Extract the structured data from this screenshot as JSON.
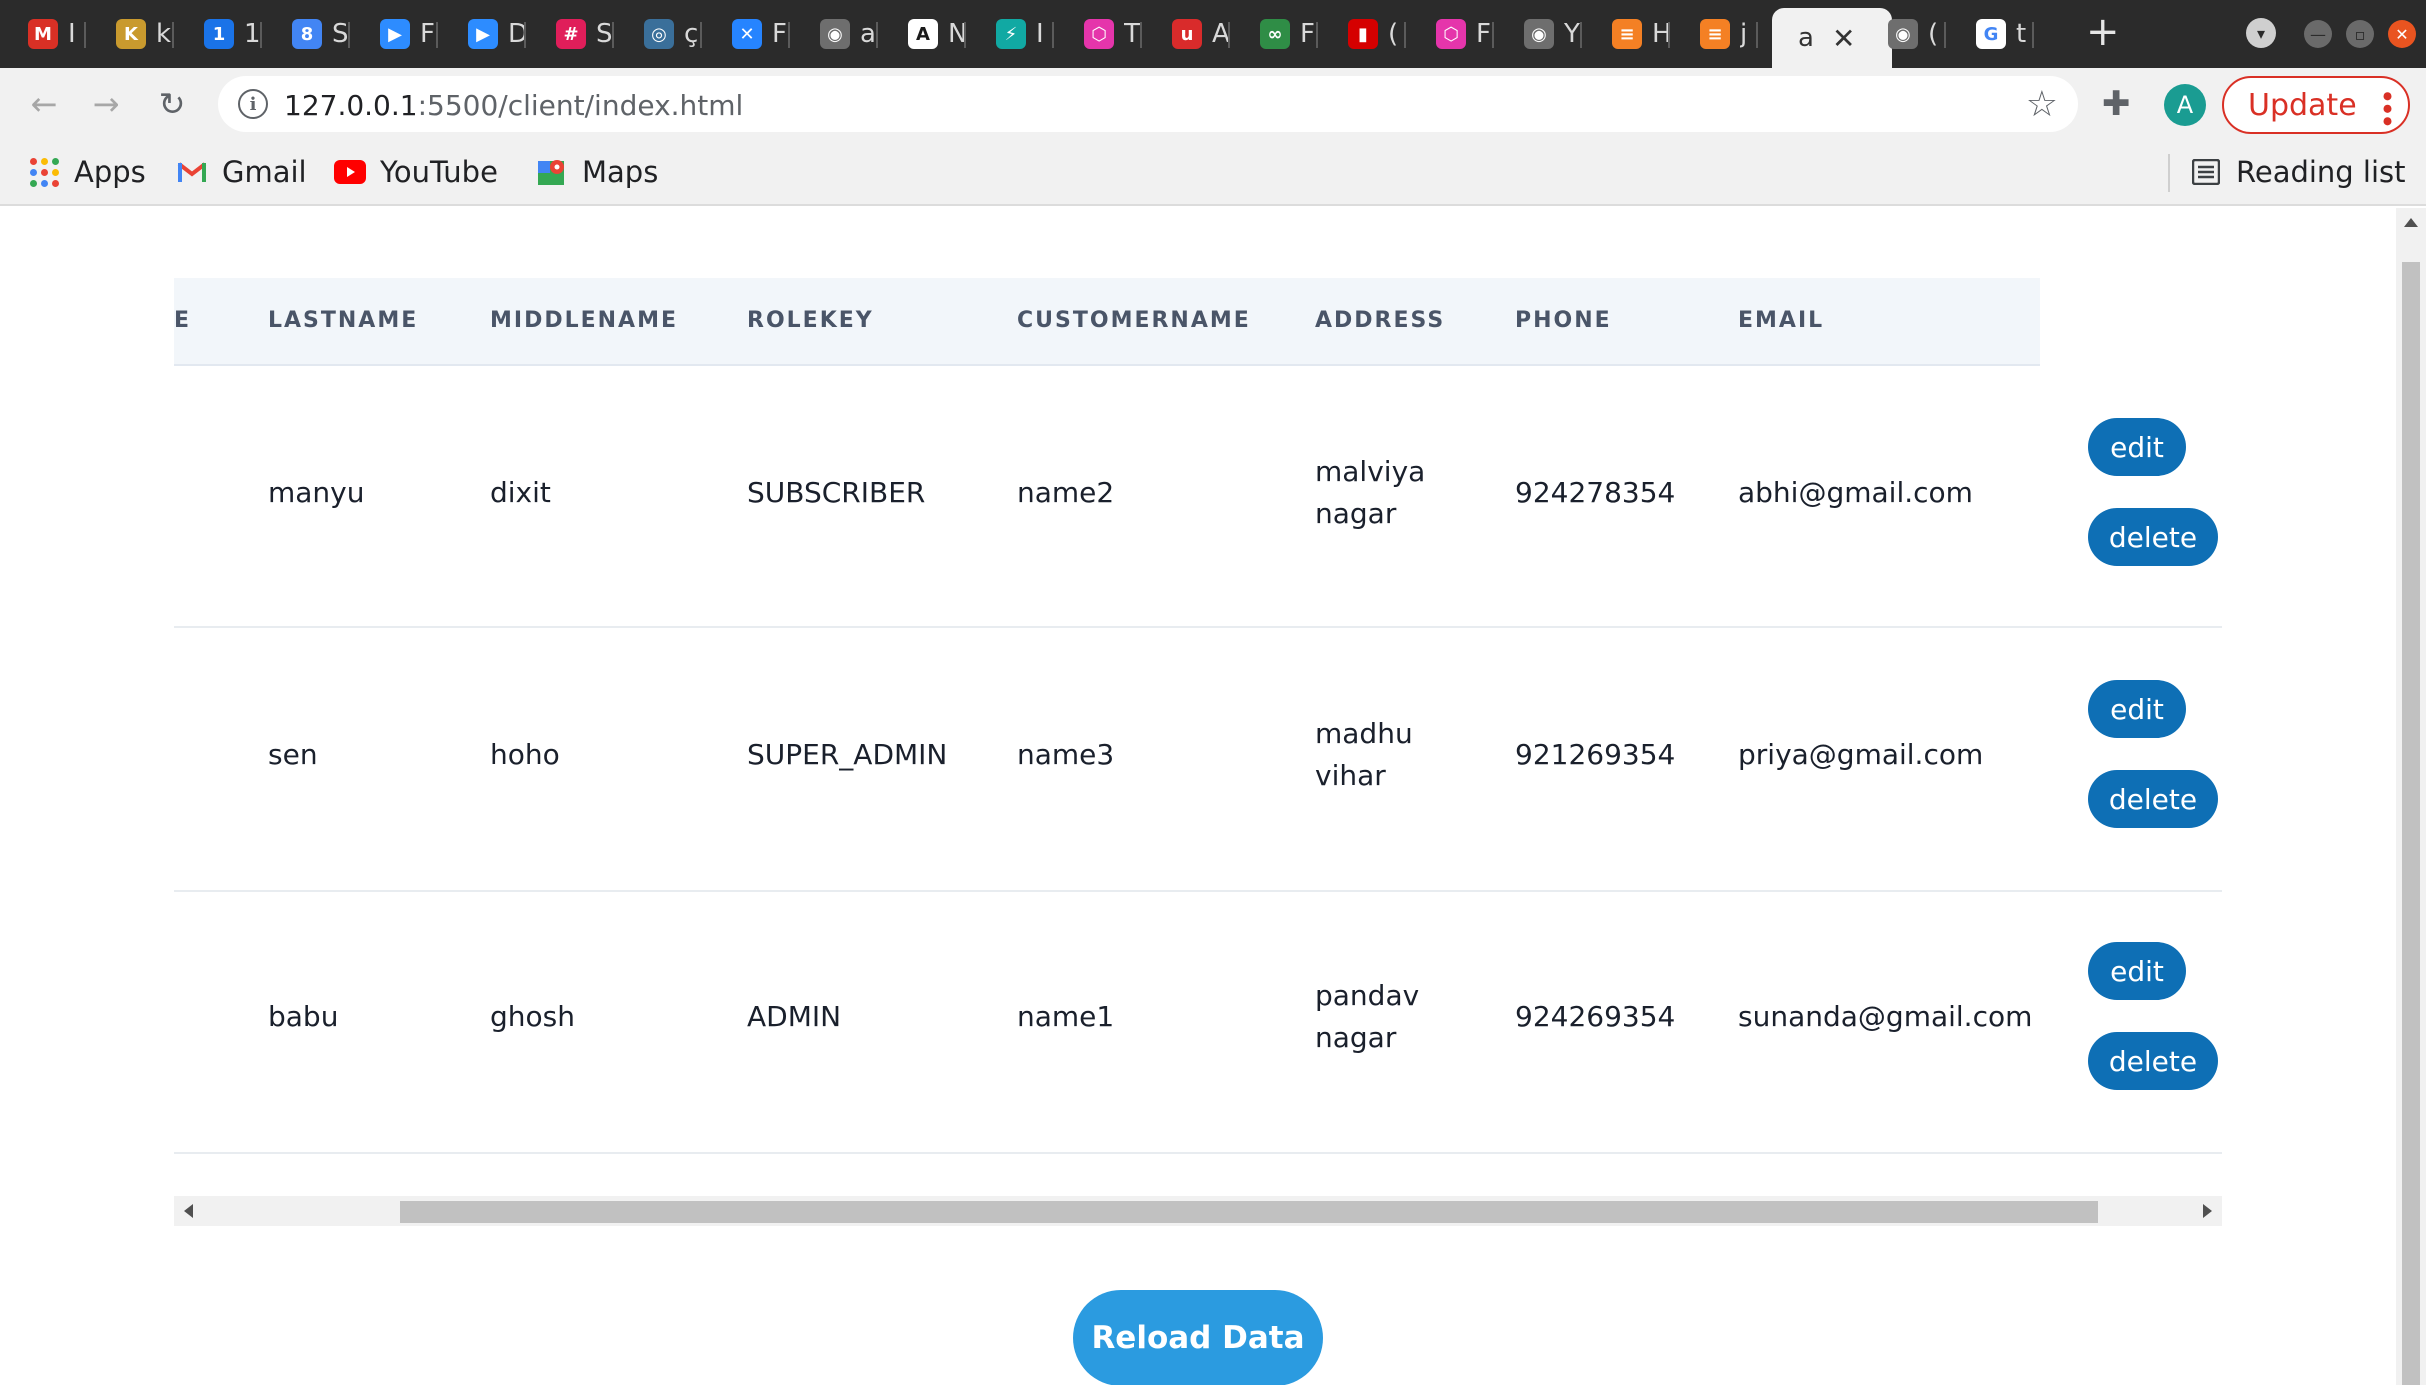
{
  "browser": {
    "tabs": [
      {
        "icon": "gmail-icon",
        "glyph": "M",
        "color": "#d93025",
        "label": "I"
      },
      {
        "icon": "app-icon",
        "glyph": "K",
        "color": "#c99a2e",
        "label": "k"
      },
      {
        "icon": "1password-icon",
        "glyph": "1",
        "color": "#1a73e8",
        "label": "1"
      },
      {
        "icon": "calendar-icon",
        "glyph": "8",
        "color": "#4285f4",
        "label": "S"
      },
      {
        "icon": "zoom-icon",
        "glyph": "▶",
        "color": "#2d8cff",
        "label": "F"
      },
      {
        "icon": "zoom-icon",
        "glyph": "▶",
        "color": "#2d8cff",
        "label": "D"
      },
      {
        "icon": "slack-icon",
        "glyph": "#",
        "color": "#e01e5a",
        "label": "S"
      },
      {
        "icon": "globe-icon",
        "glyph": "◎",
        "color": "#3a6f9a",
        "label": "ç"
      },
      {
        "icon": "xplane-icon",
        "glyph": "✕",
        "color": "#2684ff",
        "label": "F"
      },
      {
        "icon": "github-icon",
        "glyph": "◉",
        "color": "#6e6e6e",
        "label": "a"
      },
      {
        "icon": "angular-icon",
        "glyph": "A",
        "color": "#1a1a1a",
        "label": "N"
      },
      {
        "icon": "bolt-icon",
        "glyph": "⚡",
        "color": "#11a9a3",
        "label": "I"
      },
      {
        "icon": "graphql-icon",
        "glyph": "⬡",
        "color": "#e535ab",
        "label": "T"
      },
      {
        "icon": "udemy-icon",
        "glyph": "u",
        "color": "#d92b2b",
        "label": "A"
      },
      {
        "icon": "gfg-icon",
        "glyph": "∞",
        "color": "#2f8d46",
        "label": "F"
      },
      {
        "icon": "book-icon",
        "glyph": "▮",
        "color": "#d50000",
        "label": "("
      },
      {
        "icon": "graphql-icon",
        "glyph": "⬡",
        "color": "#e535ab",
        "label": "F"
      },
      {
        "icon": "github-icon",
        "glyph": "◉",
        "color": "#6e6e6e",
        "label": "Y"
      },
      {
        "icon": "stackoverflow-icon",
        "glyph": "≡",
        "color": "#f48024",
        "label": "H"
      },
      {
        "icon": "stackoverflow-icon",
        "glyph": "≡",
        "color": "#f48024",
        "label": "j"
      },
      {
        "icon": "page-icon",
        "glyph": "",
        "color": "#f1f1f1",
        "label": "a",
        "active": true
      },
      {
        "icon": "github-icon",
        "glyph": "◉",
        "color": "#6e6e6e",
        "label": "("
      },
      {
        "icon": "google-icon",
        "glyph": "G",
        "color": "#ffffff",
        "label": "t"
      }
    ],
    "url_host": "127.0.0.1",
    "url_path": ":5500/client/index.html",
    "avatar_letter": "A",
    "update_label": "Update",
    "bookmarks": {
      "apps": "Apps",
      "gmail": "Gmail",
      "youtube": "YouTube",
      "maps": "Maps",
      "reading_list": "Reading list"
    }
  },
  "table": {
    "headers": {
      "firstname_partial": "E",
      "lastname": "LASTNAME",
      "middlename": "MIDDLENAME",
      "rolekey": "ROLEKEY",
      "customername": "CUSTOMERNAME",
      "address": "ADDRESS",
      "phone": "PHONE",
      "email": "EMAIL"
    },
    "rows": [
      {
        "lastname": "manyu",
        "middlename": "dixit",
        "rolekey": "SUBSCRIBER",
        "customername": "name2",
        "address": "malviya nagar",
        "phone": "924278354",
        "email": "abhi@gmail.com",
        "edit": "edit",
        "delete": "delete"
      },
      {
        "lastname": "sen",
        "middlename": "hoho",
        "rolekey": "SUPER_ADMIN",
        "customername": "name3",
        "address": "madhu vihar",
        "phone": "921269354",
        "email": "priya@gmail.com",
        "edit": "edit",
        "delete": "delete"
      },
      {
        "lastname": "babu",
        "middlename": "ghosh",
        "rolekey": "ADMIN",
        "customername": "name1",
        "address": "pandav nagar",
        "phone": "924269354",
        "email": "sunanda@gmail.com",
        "edit": "edit",
        "delete": "delete"
      }
    ]
  },
  "reload_label": "Reload Data",
  "colors": {
    "button_primary": "#0e6fb5",
    "reload_button": "#2b9be0",
    "header_bg": "#f2f6fa"
  }
}
